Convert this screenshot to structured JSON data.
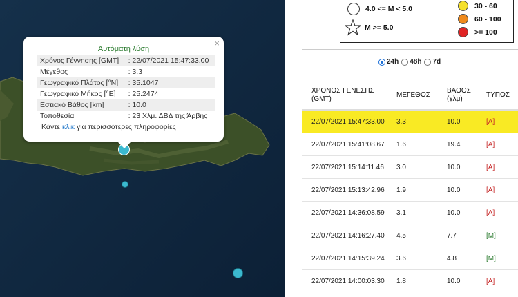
{
  "popup": {
    "title": "Αυτόματη λύση",
    "close_glyph": "×",
    "rows": [
      {
        "label": "Χρόνος Γέννησης [GMT]",
        "value": ": 22/07/2021 15:47:33.00"
      },
      {
        "label": "Μέγεθος",
        "value": ": 3.3"
      },
      {
        "label": "Γεωγραφικό Πλάτος [°N]",
        "value": ": 35.1047"
      },
      {
        "label": "Γεωγραφικό Μήκος [°E]",
        "value": ": 25.2474"
      },
      {
        "label": "Εστιακό Βάθος [km]",
        "value": ": 10.0"
      },
      {
        "label": "Τοποθεσία",
        "value": ": 23 Χλμ. ΔΒΔ της Άρβης"
      }
    ],
    "more_prefix": "Κάντε ",
    "more_link": "κλικ",
    "more_suffix": " για περισσότερες πληροφορίες"
  },
  "legend": {
    "size_mid": "4.0 <= M < 5.0",
    "size_high": "M >= 5.0",
    "depth": [
      {
        "label": "30 - 60",
        "color": "#f5e02a"
      },
      {
        "label": "60 - 100",
        "color": "#ef8a1c"
      },
      {
        "label": ">= 100",
        "color": "#e02424"
      }
    ]
  },
  "time_filter": {
    "options": [
      "24h",
      "48h",
      "7d"
    ],
    "selected": "24h"
  },
  "table": {
    "headers": [
      "ΧΡΟΝΟΣ ΓΕΝΕΣΗΣ (GMT)",
      "ΜΕΓΕΘΟΣ",
      "ΒΑΘΟΣ (χλμ)",
      "ΤΥΠΟΣ"
    ],
    "rows": [
      {
        "time": "22/07/2021 15:47:33.00",
        "mag": "3.3",
        "depth": "10.0",
        "type": "[A]",
        "highlight": true
      },
      {
        "time": "22/07/2021 15:41:08.67",
        "mag": "1.6",
        "depth": "19.4",
        "type": "[A]"
      },
      {
        "time": "22/07/2021 15:14:11.46",
        "mag": "3.0",
        "depth": "10.0",
        "type": "[A]"
      },
      {
        "time": "22/07/2021 15:13:42.96",
        "mag": "1.9",
        "depth": "10.0",
        "type": "[A]"
      },
      {
        "time": "22/07/2021 14:36:08.59",
        "mag": "3.1",
        "depth": "10.0",
        "type": "[A]"
      },
      {
        "time": "22/07/2021 14:16:27.40",
        "mag": "4.5",
        "depth": "7.7",
        "type": "[M]"
      },
      {
        "time": "22/07/2021 14:15:39.24",
        "mag": "3.6",
        "depth": "4.8",
        "type": "[M]"
      },
      {
        "time": "22/07/2021 14:00:03.30",
        "mag": "1.8",
        "depth": "10.0",
        "type": "[A]"
      }
    ]
  },
  "colors": {
    "highlight": "#f9ea24",
    "marker": "#3bb9cf",
    "popup_title": "#2e7d32",
    "link": "#1a73c8"
  }
}
